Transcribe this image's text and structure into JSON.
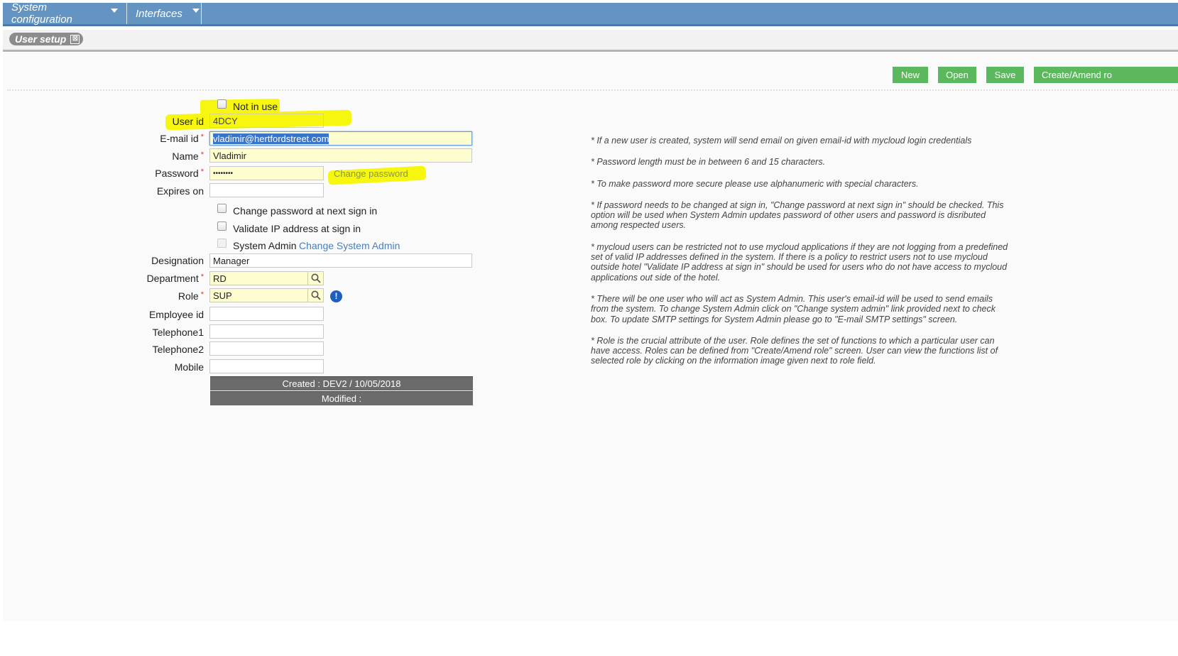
{
  "menu": {
    "items": [
      {
        "label": "System configuration"
      },
      {
        "label": "Interfaces"
      }
    ]
  },
  "tab": {
    "label": "User setup",
    "close": "⊠"
  },
  "toolbar": {
    "new_label": "New",
    "open_label": "Open",
    "save_label": "Save",
    "create_role_label": "Create/Amend ro"
  },
  "form": {
    "not_in_use_label": "Not in use",
    "user_id_label": "User id",
    "user_id_value": "4DCY",
    "email_label": "E-mail id",
    "email_value": "vladimir@hertfordstreet.com",
    "name_label": "Name",
    "name_value": "Vladimir",
    "password_label": "Password",
    "password_value": "••••••••",
    "change_password_link": "Change password",
    "expires_label": "Expires on",
    "expires_value": "",
    "change_pw_next_label": "Change password at next sign in",
    "validate_ip_label": "Validate IP address at sign in",
    "system_admin_label": "System Admin",
    "change_system_admin_link": "Change System Admin",
    "designation_label": "Designation",
    "designation_value": "Manager",
    "department_label": "Department",
    "department_value": "RD",
    "role_label": "Role",
    "role_value": "SUP",
    "employee_label": "Employee id",
    "employee_value": "",
    "tel1_label": "Telephone1",
    "tel1_value": "",
    "tel2_label": "Telephone2",
    "tel2_value": "",
    "mobile_label": "Mobile",
    "mobile_value": "",
    "required_mark": "*",
    "created": "Created : DEV2 / 10/05/2018",
    "modified": "Modified :"
  },
  "notes": [
    "* If a new user is created, system will send email on given email-id with mycloud login credentials",
    "* Password length must be in between 6 and 15 characters.",
    "* To make password more secure please use alphanumeric with special characters.",
    "* If password needs to be changed at sign in, \"Change password at next sign in\" should be checked. This option will be used when System Admin updates password of other users and password is disributed among respected users.",
    "* mycloud users can be restricted not to use mycloud applications if they are not logging from a predefined set of valid IP addresses defined in the system. If there is a policy to restrict users not to use mycloud outside hotel \"Validate IP address at sign in\" should be used for users who do not have access to mycloud applications out side of the hotel.",
    "* There will be one user who will act as System Admin. This user's email-id will be used to send emails from the system. To change System Admin click on \"Change system admin\" link provided next to check box. To update SMTP settings for System Admin please go to \"E-mail SMTP settings\" screen.",
    "* Role is the crucial attribute of the user. Role defines the set of functions to which a particular user can have access. Roles can be defined from \"Create/Amend role\" screen. User can view the functions list of selected role by clicking on the information image given next to role field."
  ],
  "info_icon": "!",
  "colors": {
    "menubar": "#6494c2",
    "button": "#5cb85c",
    "highlight": "#f6f60e",
    "required": "#dd3333"
  }
}
